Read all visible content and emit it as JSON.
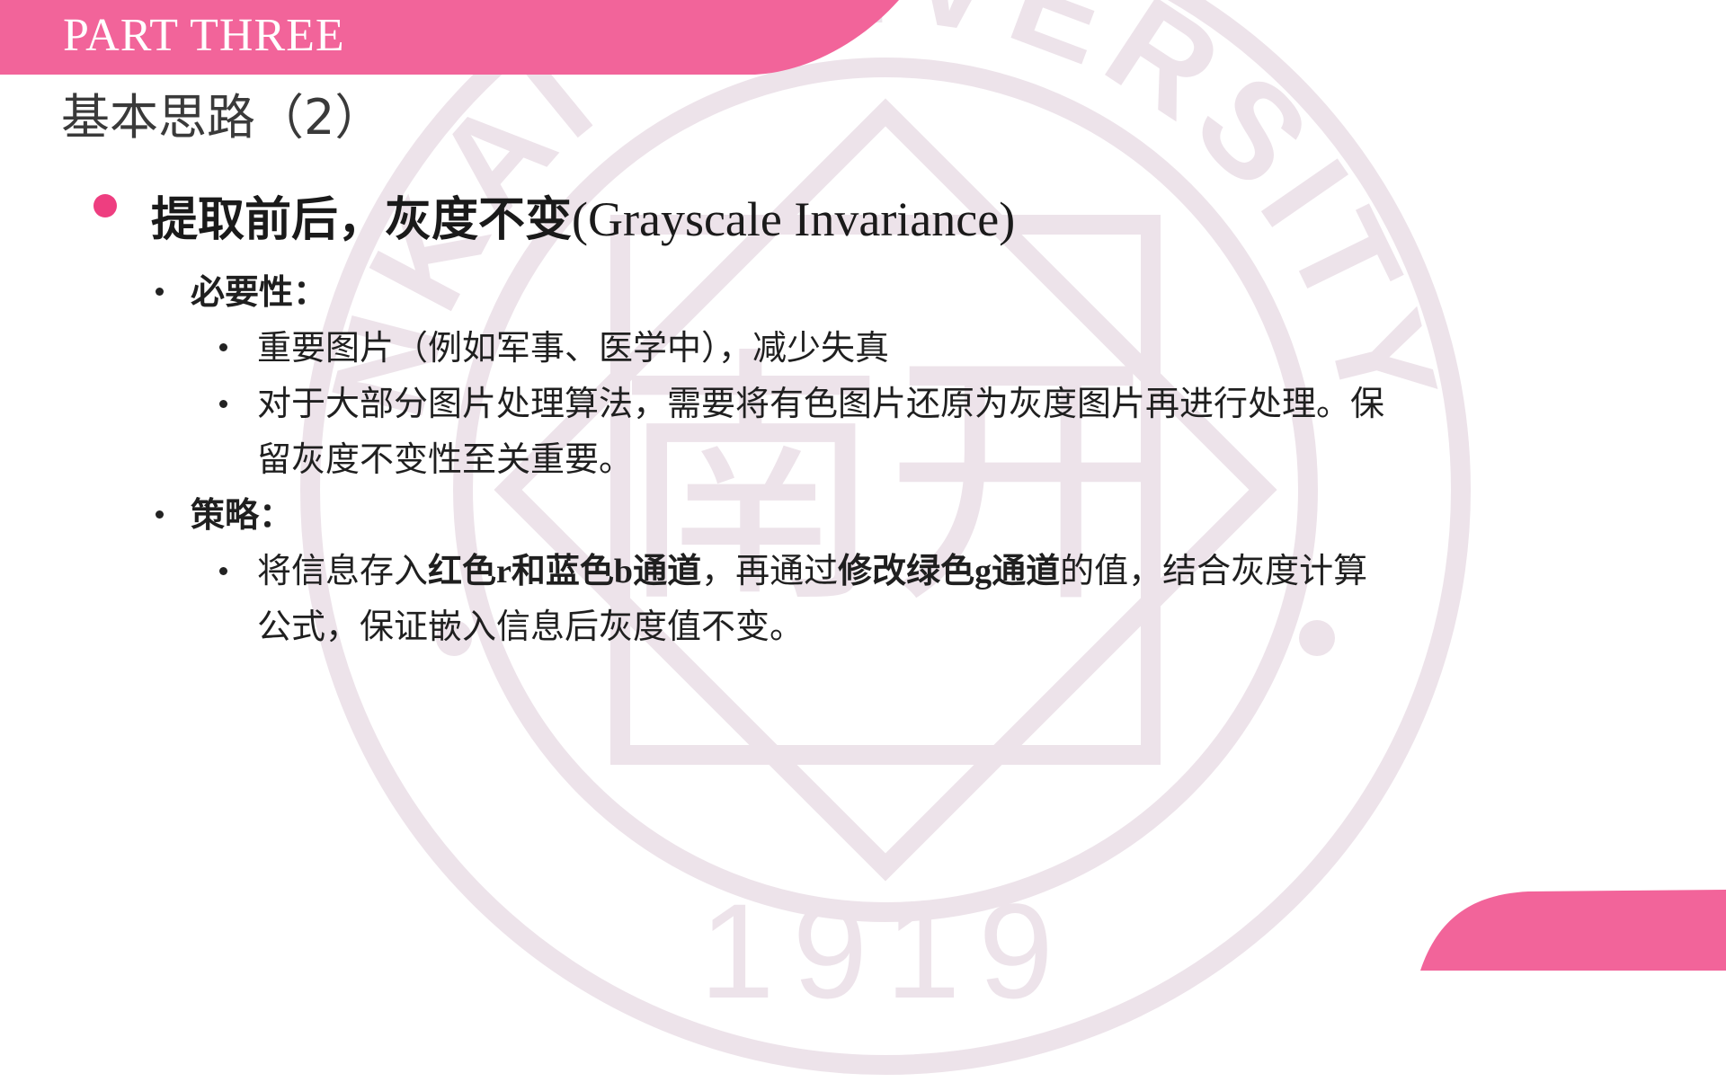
{
  "header": {
    "part_label": "PART THREE",
    "section_title": "基本思路（2）"
  },
  "watermark": {
    "ring_text": "NKAI UNIVERSITY",
    "year": "1919",
    "center_char": "南开",
    "color": "#ede3ea"
  },
  "colors": {
    "accent": "#f2649a",
    "bullet": "#ee3e80"
  },
  "main_point": {
    "title_cn": "提取前后，灰度不变",
    "title_en": "(Grayscale Invariance)"
  },
  "necessity": {
    "label": "必要性：",
    "items": [
      "重要图片（例如军事、医学中），减少失真",
      "对于大部分图片处理算法，需要将有色图片还原为灰度图片再进行处理。保",
      "留灰度不变性至关重要。"
    ]
  },
  "strategy": {
    "label": "策略：",
    "line1": {
      "p1": "将信息存入",
      "b1a": "红色",
      "b1b": "r",
      "b1c": "和蓝色",
      "b1d": "b",
      "b1e": "通道",
      "p2": "，再通过",
      "b2a": "修改绿色",
      "b2b": "g",
      "b2c": "通道",
      "p3": "的值，结合灰度计算"
    },
    "line2": "公式，保证嵌入信息后灰度值不变。"
  }
}
